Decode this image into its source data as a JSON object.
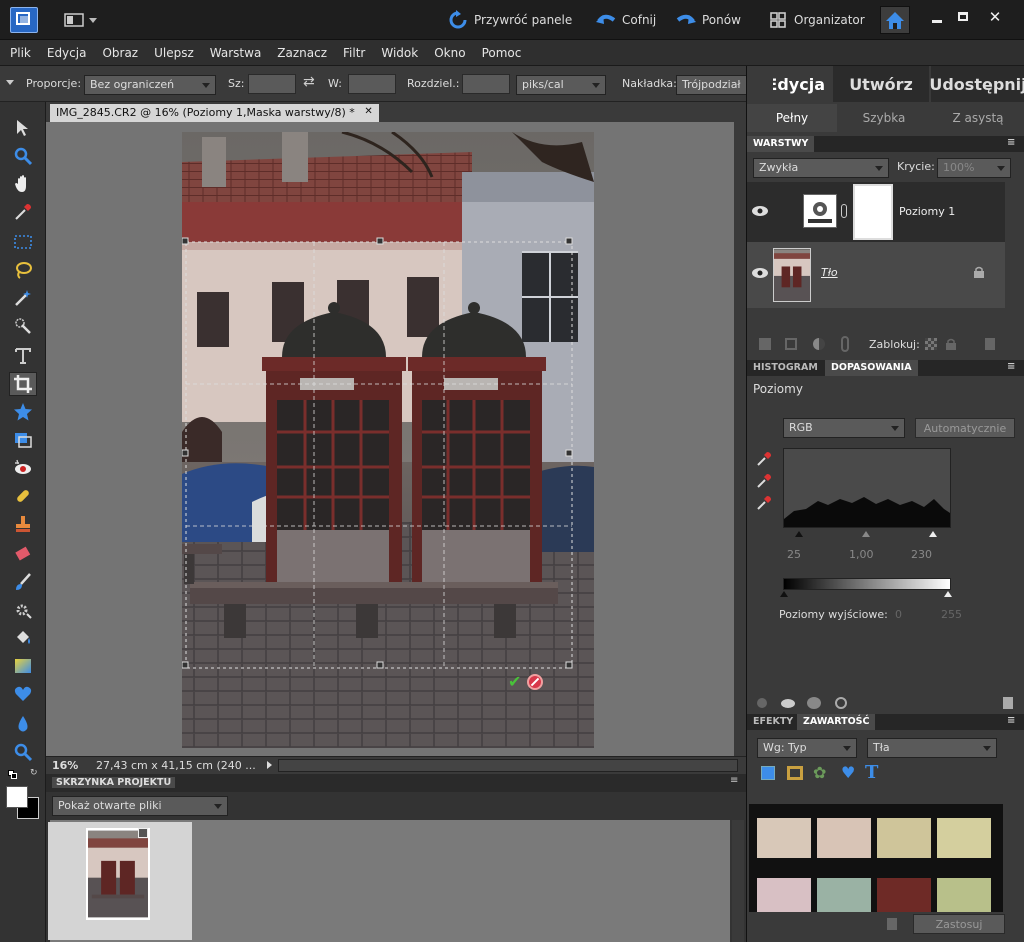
{
  "titlebar": {
    "reset_panels": "Przywróć panele",
    "undo": "Cofnij",
    "redo": "Ponów",
    "organizer": "Organizator"
  },
  "menu": [
    "Plik",
    "Edycja",
    "Obraz",
    "Ulepsz",
    "Warstwa",
    "Zaznacz",
    "Filtr",
    "Widok",
    "Okno",
    "Pomoc"
  ],
  "options": {
    "ratio_label": "Proporcje:",
    "ratio_value": "Bez ograniczeń",
    "width_label": "Sz:",
    "height_label": "W:",
    "resolution_label": "Rozdziel.:",
    "unit_value": "piks/cal",
    "overlay_label": "Nakładka:",
    "overlay_value": "Trójpodział"
  },
  "modes": {
    "edit": "Edycja",
    "create": "Utwórz",
    "share": "Udostępnij"
  },
  "submodes": {
    "full": "Pełny",
    "quick": "Szybka",
    "guided": "Z asystą"
  },
  "document": {
    "tab_title": "IMG_2845.CR2 @ 16% (Poziomy 1,Maska warstwy/8) *",
    "zoom": "16%",
    "size_info": "27,43 cm x 41,15 cm (240 ..."
  },
  "project_bin": {
    "title": "SKRZYNKA PROJEKTU",
    "dropdown": "Pokaż otwarte pliki"
  },
  "layers_panel": {
    "title": "WARSTWY",
    "blend_mode": "Zwykła",
    "opacity_label": "Krycie:",
    "opacity_value": "100%",
    "lock_label": "Zablokuj:",
    "layers": [
      {
        "name": "Poziomy 1"
      },
      {
        "name": "Tło"
      }
    ]
  },
  "adjust_panel": {
    "tab_histogram": "HISTOGRAM",
    "tab_adjust": "DOPASOWANIA",
    "title": "Poziomy",
    "channel": "RGB",
    "auto_button": "Automatycznie",
    "input_black": "25",
    "input_gamma": "1,00",
    "input_white": "230",
    "output_label": "Poziomy wyjściowe:",
    "output_black": "0",
    "output_white": "255"
  },
  "content_panel": {
    "tab_effects": "EFEKTY",
    "tab_content": "ZAWARTOŚĆ",
    "filter_type": "Wg: Typ",
    "filter_value": "Tła",
    "apply_button": "Zastosuj"
  },
  "colors": {
    "accent_blue": "#3d8de8",
    "panel_dark": "#3a3a3a",
    "canvas_bg": "#747474"
  }
}
